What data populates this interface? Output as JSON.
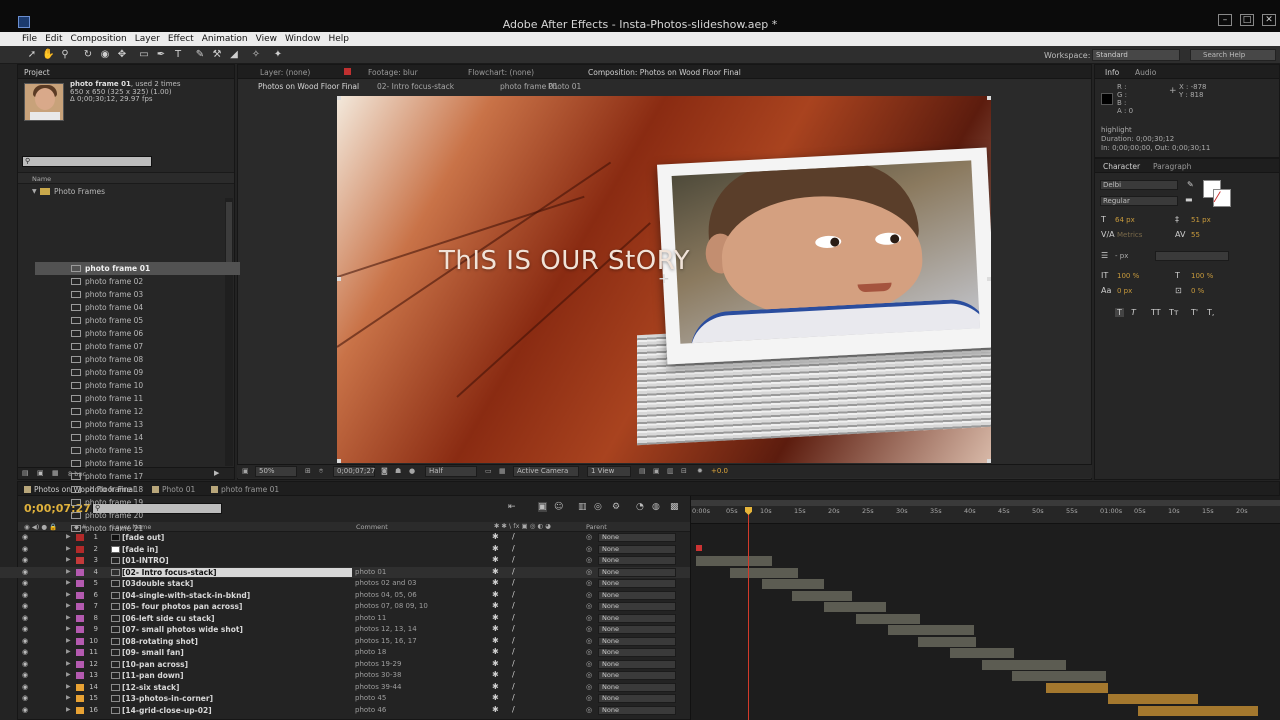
{
  "window": {
    "title": "Adobe After Effects - Insta-Photos-slideshow.aep *"
  },
  "menu": [
    "File",
    "Edit",
    "Composition",
    "Layer",
    "Effect",
    "Animation",
    "View",
    "Window",
    "Help"
  ],
  "toolbar": {
    "workspace_label": "Workspace:",
    "workspace_value": "Standard",
    "search_placeholder": "Search Help"
  },
  "project": {
    "tab": "Project",
    "item_name": "photo frame 01",
    "item_used": ", used 2 times",
    "item_dims": "650 x 650  (325 x 325) (1.00)",
    "item_duration": "Δ 0;00;30;12, 29.97 fps",
    "col_name": "Name",
    "folder": "Photo Frames",
    "items": [
      "photo frame 01",
      "photo frame 02",
      "photo frame 03",
      "photo frame 04",
      "photo frame 05",
      "photo frame 06",
      "photo frame 07",
      "photo frame 08",
      "photo frame 09",
      "photo frame 10",
      "photo frame 11",
      "photo frame 12",
      "photo frame 13",
      "photo frame 14",
      "photo frame 15",
      "photo frame 16",
      "photo frame 17",
      "photo frame 18",
      "photo frame 19",
      "photo frame 20",
      "photo frame 21"
    ],
    "bpc": "8 bpc"
  },
  "viewer_tabs": {
    "layer": "Layer: (none)",
    "footage": "Footage: blur",
    "flowchart": "Flowchart: (none)",
    "composition": "Composition: Photos on Wood Floor Final"
  },
  "breadcrumbs": [
    "Photos on Wood Floor Final",
    "02- Intro focus-stack",
    "photo frame 01",
    "Photo 01"
  ],
  "viewer": {
    "overlay_text": "ThIS IS OUR StORY",
    "zoom": "50%",
    "timecode": "0;00;07;27",
    "resolution": "Half",
    "camera": "Active Camera",
    "views": "1 View",
    "exposure": "+0.0"
  },
  "info": {
    "tab_info": "Info",
    "tab_audio": "Audio",
    "r": "R :",
    "g": "G :",
    "b": "B :",
    "a": "A : 0",
    "x": "X : -878",
    "y": "Y : 818",
    "highlight": "highlight",
    "duration": "Duration: 0;00;30;12",
    "inout": "In: 0;00;00;00, Out: 0;00;30;11"
  },
  "character": {
    "tab_character": "Character",
    "tab_paragraph": "Paragraph",
    "font": "Delbi",
    "style": "Regular",
    "size": "64 px",
    "leading": "51 px",
    "kerning": "Metrics",
    "tracking": "55",
    "stroke": "- px",
    "v_scale": "100 %",
    "h_scale": "100 %",
    "baseline": "0 px",
    "tsume": "0 %"
  },
  "timeline": {
    "tabs": [
      "Photos on Wood Floor Final",
      "Photo 01",
      "photo frame 01"
    ],
    "timecode": "0;00;07;27",
    "col_layer": "Layer Name",
    "col_comment": "Comment",
    "col_parent": "Parent",
    "ruler": [
      "0:00s",
      "05s",
      "10s",
      "15s",
      "20s",
      "25s",
      "30s",
      "35s",
      "40s",
      "45s",
      "50s",
      "55s",
      "01:00s",
      "05s",
      "10s",
      "15s",
      "20s"
    ],
    "layers": [
      {
        "num": "1",
        "name": "[fade out]",
        "comment": "",
        "parent": "None",
        "color": "#b22a2a",
        "solid": "#111111"
      },
      {
        "num": "2",
        "name": "[fade in]",
        "comment": "",
        "parent": "None",
        "color": "#b22a2a",
        "solid": "#ffffff"
      },
      {
        "num": "3",
        "name": "[01-INTRO]",
        "comment": "",
        "parent": "None",
        "color": "#c43a3a",
        "solid": ""
      },
      {
        "num": "4",
        "name": "[02- Intro focus-stack]",
        "comment": "photo 01",
        "parent": "None",
        "color": "#b45ab0",
        "solid": ""
      },
      {
        "num": "5",
        "name": "[03double stack]",
        "comment": "photos 02 and 03",
        "parent": "None",
        "color": "#b45ab0",
        "solid": ""
      },
      {
        "num": "6",
        "name": "[04-single-with-stack-in-bknd]",
        "comment": "photos 04, 05, 06",
        "parent": "None",
        "color": "#b45ab0",
        "solid": ""
      },
      {
        "num": "7",
        "name": "[05- four photos pan across]",
        "comment": "photos 07, 08 09, 10",
        "parent": "None",
        "color": "#b45ab0",
        "solid": ""
      },
      {
        "num": "8",
        "name": "[06-left side cu stack]",
        "comment": "photo 11",
        "parent": "None",
        "color": "#b45ab0",
        "solid": ""
      },
      {
        "num": "9",
        "name": "[07- small photos wide shot]",
        "comment": "photos 12, 13, 14",
        "parent": "None",
        "color": "#b45ab0",
        "solid": ""
      },
      {
        "num": "10",
        "name": "[08-rotating shot]",
        "comment": "photos 15, 16, 17",
        "parent": "None",
        "color": "#b45ab0",
        "solid": ""
      },
      {
        "num": "11",
        "name": "[09- small fan]",
        "comment": "photo 18",
        "parent": "None",
        "color": "#b45ab0",
        "solid": ""
      },
      {
        "num": "12",
        "name": "[10-pan across]",
        "comment": "photos 19-29",
        "parent": "None",
        "color": "#b45ab0",
        "solid": ""
      },
      {
        "num": "13",
        "name": "[11-pan down]",
        "comment": "photos 30-38",
        "parent": "None",
        "color": "#b45ab0",
        "solid": ""
      },
      {
        "num": "14",
        "name": "[12-six stack]",
        "comment": "photos 39-44",
        "parent": "None",
        "color": "#e8a234",
        "solid": ""
      },
      {
        "num": "15",
        "name": "[13-photos-in-corner]",
        "comment": "photo 45",
        "parent": "None",
        "color": "#e8a234",
        "solid": ""
      },
      {
        "num": "16",
        "name": "[14-grid-close-up-02]",
        "comment": "photo 46",
        "parent": "None",
        "color": "#e8a234",
        "solid": ""
      }
    ]
  }
}
